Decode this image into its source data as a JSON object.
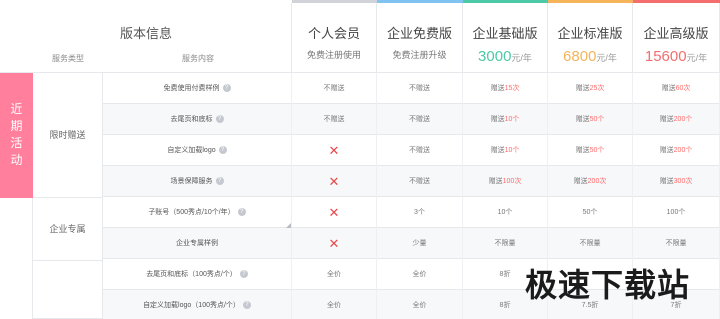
{
  "header": {
    "info_title": "版本信息",
    "service_type_label": "服务类型",
    "service_content_label": "服务内容"
  },
  "plans": [
    {
      "name": "个人会员",
      "sub": "免费注册使用",
      "accent": "#d0d3d8"
    },
    {
      "name": "企业免费版",
      "sub": "免费注册升级",
      "accent": "#7ec3f2"
    },
    {
      "name": "企业基础版",
      "price": "3000",
      "unit": "元/年",
      "accent": "#4cc9a6"
    },
    {
      "name": "企业标准版",
      "price": "6800",
      "unit": "元/年",
      "accent": "#f5b45a"
    },
    {
      "name": "企业高级版",
      "price": "15600",
      "unit": "元/年",
      "accent": "#f46e6e"
    }
  ],
  "activity_label": "近期活动",
  "groups": [
    {
      "type": "限时赠送"
    },
    {
      "type": "企业专属"
    }
  ],
  "rows": [
    {
      "feature": "免费使用付费样例",
      "help": true,
      "cells": [
        {
          "t": "不赠送"
        },
        {
          "t": "不赠送"
        },
        {
          "p": "赠送",
          "n": "15",
          "s": "次"
        },
        {
          "p": "赠送",
          "n": "25",
          "s": "次"
        },
        {
          "p": "赠送",
          "n": "60",
          "s": "次"
        }
      ]
    },
    {
      "feature": "去尾页和底标",
      "help": true,
      "cells": [
        {
          "t": "不赠送"
        },
        {
          "t": "不赠送"
        },
        {
          "p": "赠送",
          "n": "10",
          "s": "个"
        },
        {
          "p": "赠送",
          "n": "50",
          "s": "个"
        },
        {
          "p": "赠送",
          "n": "200",
          "s": "个"
        }
      ]
    },
    {
      "feature": "自定义加载logo",
      "help": true,
      "cells": [
        {
          "x": true
        },
        {
          "t": "不赠送"
        },
        {
          "p": "赠送",
          "n": "10",
          "s": "个"
        },
        {
          "p": "赠送",
          "n": "50",
          "s": "个"
        },
        {
          "p": "赠送",
          "n": "200",
          "s": "个"
        }
      ]
    },
    {
      "feature": "场景保障服务",
      "help": true,
      "cells": [
        {
          "x": true
        },
        {
          "t": "不赠送"
        },
        {
          "p": "赠送",
          "n": "100",
          "s": "次"
        },
        {
          "p": "赠送",
          "n": "200",
          "s": "次"
        },
        {
          "p": "赠送",
          "n": "300",
          "s": "次"
        }
      ]
    },
    {
      "feature": "子账号（500秀点/10个/年）",
      "help": true,
      "cells": [
        {
          "x": true
        },
        {
          "t": "3个"
        },
        {
          "t": "10个"
        },
        {
          "t": "50个"
        },
        {
          "t": "100个"
        }
      ]
    },
    {
      "feature": "企业专属样例",
      "help": false,
      "cells": [
        {
          "x": true
        },
        {
          "t": "少量"
        },
        {
          "t": "不限量"
        },
        {
          "t": "不限量"
        },
        {
          "t": "不限量"
        }
      ]
    },
    {
      "feature": "去尾页和底标（100秀点/个）",
      "help": true,
      "cells": [
        {
          "t": "全价"
        },
        {
          "t": "全价"
        },
        {
          "t": "8折"
        },
        {
          "t": ""
        },
        {
          "t": ""
        }
      ]
    },
    {
      "feature": "自定义加载logo（100秀点/个）",
      "help": true,
      "cells": [
        {
          "t": "全价"
        },
        {
          "t": "全价"
        },
        {
          "t": "8折"
        },
        {
          "t": "7.5折"
        },
        {
          "t": "7折"
        }
      ]
    }
  ],
  "watermark": "极速下载站",
  "colors": {
    "activity_bg": "#ff7f9c",
    "highlight": "#ff6a6a",
    "x_mark": "#e84a4a"
  }
}
